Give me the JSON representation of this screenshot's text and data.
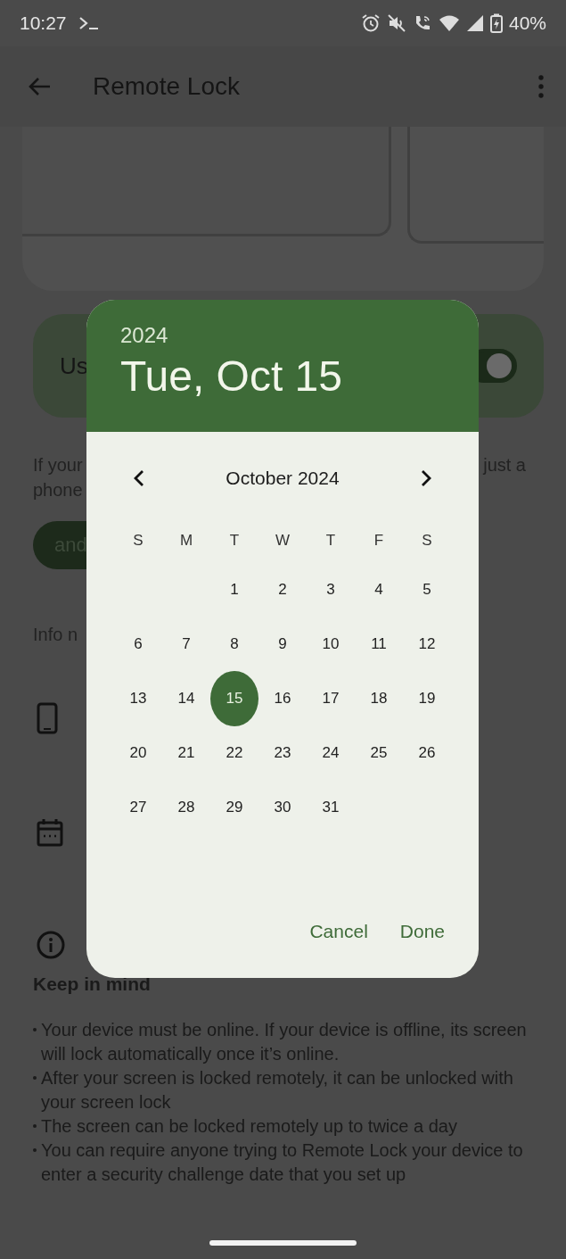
{
  "status_bar": {
    "time": "10:27",
    "battery": "40%"
  },
  "app_bar": {
    "title": "Remote Lock"
  },
  "background": {
    "toggle_row": {
      "label": "Us",
      "on": true
    },
    "paragraph_left": [
      "If your",
      "phone"
    ],
    "paragraph_right": "just a",
    "chip": "and",
    "section_label": "Info n"
  },
  "keep_in_mind": {
    "title": "Keep in mind",
    "bullets": [
      "Your device must be online. If your device is offline, its screen will lock automatically once it’s online.",
      "After your screen is locked remotely, it can be unlocked with your screen lock",
      "The screen can be locked remotely up to twice a day",
      "You can require anyone trying to Remote Lock your device to enter a security challenge date that you set up"
    ]
  },
  "date_picker": {
    "year": "2024",
    "date": "Tue, Oct 15",
    "month": "October 2024",
    "weekdays": [
      "S",
      "M",
      "T",
      "W",
      "T",
      "F",
      "S"
    ],
    "weeks": [
      {
        "kind": "partial_start",
        "days": [
          {
            "label": "1",
            "selected": false
          },
          {
            "label": "2",
            "selected": false
          },
          {
            "label": "3",
            "selected": false
          },
          {
            "label": "4",
            "selected": false
          },
          {
            "label": "5",
            "selected": false
          }
        ]
      },
      {
        "kind": "full",
        "days": [
          {
            "label": "6",
            "selected": false
          },
          {
            "label": "7",
            "selected": false
          },
          {
            "label": "8",
            "selected": false
          },
          {
            "label": "9",
            "selected": false
          },
          {
            "label": "10",
            "selected": false
          },
          {
            "label": "11",
            "selected": false
          },
          {
            "label": "12",
            "selected": false
          }
        ]
      },
      {
        "kind": "full",
        "days": [
          {
            "label": "13",
            "selected": false
          },
          {
            "label": "14",
            "selected": false
          },
          {
            "label": "15",
            "selected": true
          },
          {
            "label": "16",
            "selected": false
          },
          {
            "label": "17",
            "selected": false
          },
          {
            "label": "18",
            "selected": false
          },
          {
            "label": "19",
            "selected": false
          }
        ]
      },
      {
        "kind": "full",
        "days": [
          {
            "label": "20",
            "selected": false
          },
          {
            "label": "21",
            "selected": false
          },
          {
            "label": "22",
            "selected": false
          },
          {
            "label": "23",
            "selected": false
          },
          {
            "label": "24",
            "selected": false
          },
          {
            "label": "25",
            "selected": false
          },
          {
            "label": "26",
            "selected": false
          }
        ]
      },
      {
        "kind": "partial_end",
        "days": [
          {
            "label": "27",
            "selected": false
          },
          {
            "label": "28",
            "selected": false
          },
          {
            "label": "29",
            "selected": false
          },
          {
            "label": "30",
            "selected": false
          },
          {
            "label": "31",
            "selected": false
          }
        ]
      }
    ],
    "actions": [
      "Cancel",
      "Done"
    ]
  }
}
